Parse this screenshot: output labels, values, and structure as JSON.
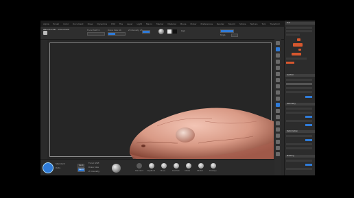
{
  "app": {
    "title": "ZBrush 2021 - Document",
    "menus": [
      "Alpha",
      "Brush",
      "Color",
      "Document",
      "Draw",
      "Dynamics",
      "Edit",
      "File",
      "Layer",
      "Light",
      "Macro",
      "Marker",
      "Material",
      "Movie",
      "Picker",
      "Preferences",
      "Render",
      "Stencil",
      "Stroke",
      "Texture",
      "Tool",
      "Transform",
      "Zplugin",
      "Zscript"
    ]
  },
  "topbar": {
    "ctl1": "Focal Shift 0",
    "ctl2": "Draw Size 64",
    "ctl3": "Z Intensity 25",
    "rgb_label": "Rgb",
    "mrgb_label": "Mrgb"
  },
  "right_panel": {
    "header_tool": "Tool",
    "header_subtool": "SubTool",
    "header_geometry": "Geometry",
    "header_deformation": "Deformation",
    "header_masking": "Masking"
  },
  "bottom": {
    "lbl_brush": "Standard",
    "lbl_dots": "Dots",
    "btn_zadd": "Zadd",
    "btn_zsub": "Zsub",
    "lbl_focal": "Focal Shift",
    "lbl_draw": "Draw Size",
    "lbl_int": "Z Intensity",
    "brushes": [
      "Standard",
      "ClayBuild",
      "Move",
      "DamStd",
      "Inflate",
      "hPolish",
      "TrimDyn"
    ]
  },
  "colors": {
    "accent": "#2f7bd8",
    "skin": "#e0a08c",
    "orange": "#d7572e"
  }
}
